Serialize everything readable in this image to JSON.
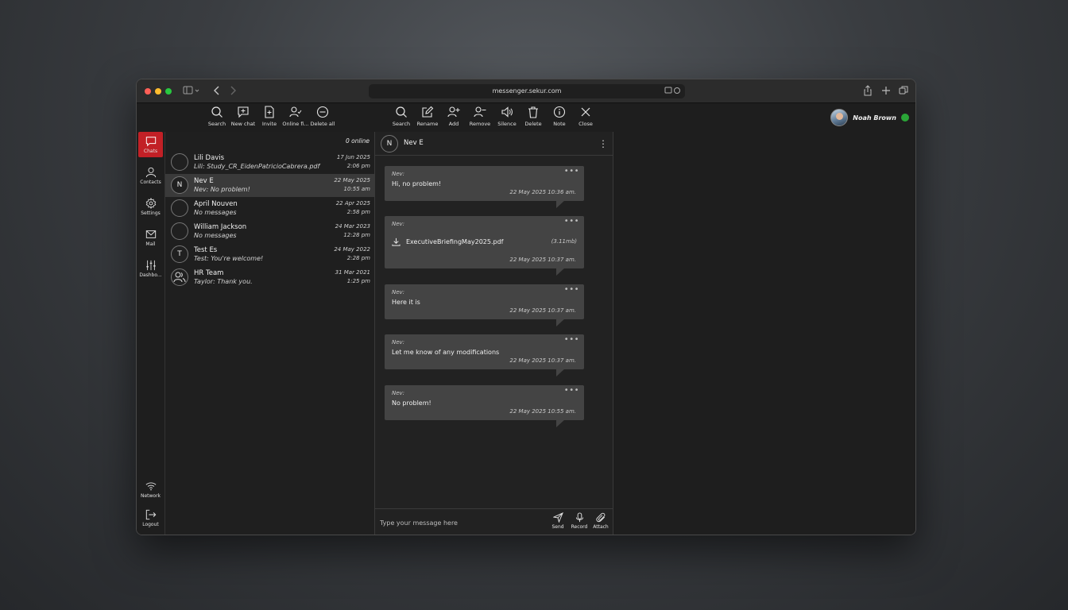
{
  "browser": {
    "url": "messenger.sekur.com"
  },
  "toolbar_left": [
    {
      "label": "Search",
      "icon": "search-icon"
    },
    {
      "label": "New chat",
      "icon": "new-chat-icon"
    },
    {
      "label": "Invite",
      "icon": "invite-icon"
    },
    {
      "label": "Online fi...",
      "icon": "online-filter-icon"
    },
    {
      "label": "Delete all",
      "icon": "delete-all-icon"
    }
  ],
  "toolbar_right": [
    {
      "label": "Search",
      "icon": "search-icon"
    },
    {
      "label": "Rename",
      "icon": "rename-icon"
    },
    {
      "label": "Add",
      "icon": "add-user-icon"
    },
    {
      "label": "Remove",
      "icon": "remove-user-icon"
    },
    {
      "label": "Silence",
      "icon": "speaker-icon"
    },
    {
      "label": "Delete",
      "icon": "trash-icon"
    },
    {
      "label": "Note",
      "icon": "info-icon"
    },
    {
      "label": "Close",
      "icon": "close-icon"
    }
  ],
  "user": {
    "name": "Noah Brown",
    "status_color": "#2aa537"
  },
  "nav": [
    {
      "label": "Chats",
      "icon": "chat-icon",
      "active": true
    },
    {
      "label": "Contacts",
      "icon": "contacts-icon"
    },
    {
      "label": "Settings",
      "icon": "gear-icon"
    },
    {
      "label": "Mail",
      "icon": "mail-icon"
    },
    {
      "label": "Dashbo...",
      "icon": "sliders-icon"
    }
  ],
  "nav_bottom": [
    {
      "label": "Network",
      "icon": "wifi-icon"
    },
    {
      "label": "Logout",
      "icon": "logout-icon"
    }
  ],
  "chat_list": {
    "online_count": "0 online",
    "items": [
      {
        "name": "Lili Davis",
        "preview": "Lili: Study_CR_EidenPatricioCabrera.pdf",
        "date": "17 Jun 2025",
        "time": "2:06 pm",
        "avatar": "photo"
      },
      {
        "name": "Nev E",
        "preview": "Nev: No problem!",
        "date": "22 May 2025",
        "time": "10:55 am",
        "avatar": "N",
        "selected": true
      },
      {
        "name": "April Nouven",
        "preview": "No messages",
        "date": "22 Apr 2025",
        "time": "2:58 pm",
        "avatar": "photo"
      },
      {
        "name": "William Jackson",
        "preview": "No messages",
        "date": "24 Mar 2023",
        "time": "12:28 pm",
        "avatar": "photo"
      },
      {
        "name": "Test Es",
        "preview": "Test: You're welcome!",
        "date": "24 May 2022",
        "time": "2:28 pm",
        "avatar": "T"
      },
      {
        "name": "HR Team",
        "preview": "Taylor: Thank you.",
        "date": "31 Mar 2021",
        "time": "1:25 pm",
        "avatar": "group"
      }
    ]
  },
  "conversation": {
    "initial": "N",
    "name": "Nev E",
    "messages": [
      {
        "from": "Nev:",
        "text": "Hi, no problem!",
        "timestamp": "22 May 2025 10:36 am."
      },
      {
        "from": "Nev:",
        "file": {
          "name": "ExecutiveBriefingMay2025.pdf",
          "size": "(3.11mb)"
        },
        "timestamp": "22 May 2025 10:37 am."
      },
      {
        "from": "Nev:",
        "text": "Here it is",
        "timestamp": "22 May 2025 10:37 am."
      },
      {
        "from": "Nev:",
        "text": "Let me know of any modifications",
        "timestamp": "22 May 2025 10:37 am."
      },
      {
        "from": "Nev:",
        "text": "No problem!",
        "timestamp": "22 May 2025 10:55 am."
      }
    ],
    "more_glyph": "•••"
  },
  "composer": {
    "placeholder": "Type your message here",
    "send_label": "Send",
    "record_label": "Record",
    "attach_label": "Attach"
  }
}
